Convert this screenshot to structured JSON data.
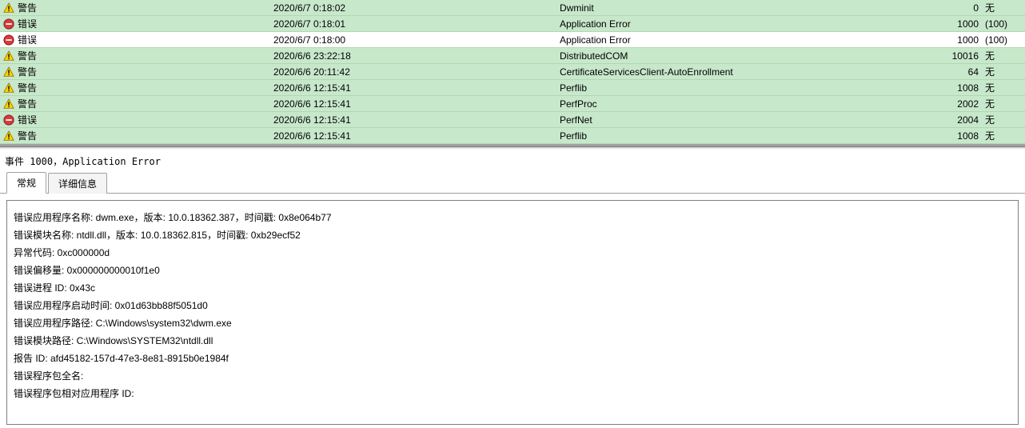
{
  "events": [
    {
      "icon": "warning",
      "level": "警告",
      "datetime": "2020/6/7 0:18:02",
      "source": "Dwminit",
      "id": "0",
      "task": "无",
      "selected": false
    },
    {
      "icon": "error",
      "level": "错误",
      "datetime": "2020/6/7 0:18:01",
      "source": "Application Error",
      "id": "1000",
      "task": "(100)",
      "selected": false
    },
    {
      "icon": "error",
      "level": "错误",
      "datetime": "2020/6/7 0:18:00",
      "source": "Application Error",
      "id": "1000",
      "task": "(100)",
      "selected": true
    },
    {
      "icon": "warning",
      "level": "警告",
      "datetime": "2020/6/6 23:22:18",
      "source": "DistributedCOM",
      "id": "10016",
      "task": "无",
      "selected": false
    },
    {
      "icon": "warning",
      "level": "警告",
      "datetime": "2020/6/6 20:11:42",
      "source": "CertificateServicesClient-AutoEnrollment",
      "id": "64",
      "task": "无",
      "selected": false
    },
    {
      "icon": "warning",
      "level": "警告",
      "datetime": "2020/6/6 12:15:41",
      "source": "Perflib",
      "id": "1008",
      "task": "无",
      "selected": false
    },
    {
      "icon": "warning",
      "level": "警告",
      "datetime": "2020/6/6 12:15:41",
      "source": "PerfProc",
      "id": "2002",
      "task": "无",
      "selected": false
    },
    {
      "icon": "error",
      "level": "错误",
      "datetime": "2020/6/6 12:15:41",
      "source": "PerfNet",
      "id": "2004",
      "task": "无",
      "selected": false
    },
    {
      "icon": "warning",
      "level": "警告",
      "datetime": "2020/6/6 12:15:41",
      "source": "Perflib",
      "id": "1008",
      "task": "无",
      "selected": false
    }
  ],
  "detail_title": "事件 1000，Application Error",
  "tabs": {
    "general": "常规",
    "details": "详细信息"
  },
  "detail_lines": [
    "错误应用程序名称: dwm.exe，版本: 10.0.18362.387，时间戳: 0x8e064b77",
    "错误模块名称: ntdll.dll，版本: 10.0.18362.815，时间戳: 0xb29ecf52",
    "异常代码: 0xc000000d",
    "错误偏移量: 0x000000000010f1e0",
    "错误进程 ID: 0x43c",
    "错误应用程序启动时间: 0x01d63bb88f5051d0",
    "错误应用程序路径: C:\\Windows\\system32\\dwm.exe",
    "错误模块路径: C:\\Windows\\SYSTEM32\\ntdll.dll",
    "报告 ID: afd45182-157d-47e3-8e81-8915b0e1984f",
    "错误程序包全名:",
    "错误程序包相对应用程序 ID:"
  ]
}
